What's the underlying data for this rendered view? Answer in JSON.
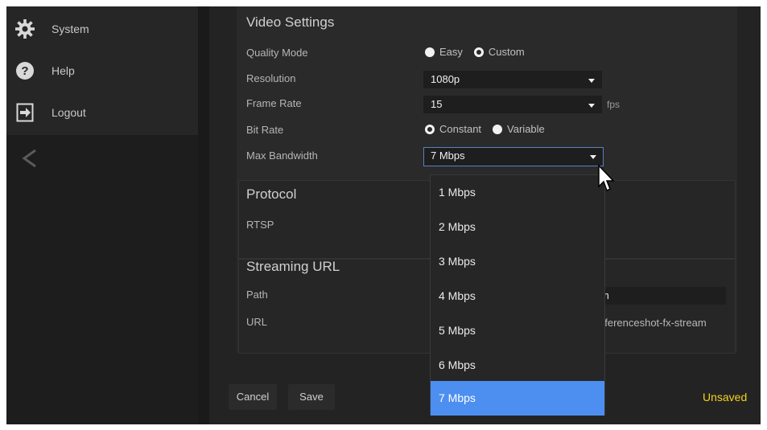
{
  "sidebar": {
    "items": [
      {
        "label": "System",
        "icon": "gear-icon"
      },
      {
        "label": "Help",
        "icon": "help-icon"
      },
      {
        "label": "Logout",
        "icon": "logout-icon"
      }
    ],
    "collapse_icon": "chevron-left-icon"
  },
  "video_settings": {
    "title": "Video Settings",
    "quality_mode": {
      "label": "Quality Mode",
      "options": [
        "Easy",
        "Custom"
      ],
      "selected": "Custom"
    },
    "resolution": {
      "label": "Resolution",
      "value": "1080p"
    },
    "frame_rate": {
      "label": "Frame Rate",
      "value": "15",
      "unit": "fps"
    },
    "bit_rate": {
      "label": "Bit Rate",
      "options": [
        "Constant",
        "Variable"
      ],
      "selected": "Constant"
    },
    "max_bandwidth": {
      "label": "Max Bandwidth",
      "value": "7 Mbps",
      "options": [
        "1 Mbps",
        "2 Mbps",
        "3 Mbps",
        "4 Mbps",
        "5 Mbps",
        "6 Mbps",
        "7 Mbps"
      ],
      "selected_index": 6
    }
  },
  "protocol": {
    "title": "Protocol",
    "rtsp_label": "RTSP"
  },
  "streaming_url": {
    "title": "Streaming URL",
    "path_label": "Path",
    "path_value": "m",
    "url_label": "URL",
    "url_value": "nferenceshot-fx-stream"
  },
  "footer": {
    "cancel_label": "Cancel",
    "save_label": "Save",
    "status_text": "Unsaved"
  },
  "colors": {
    "accent": "#4d8ff0",
    "unsaved": "#f2d21c",
    "background": "#1a1a1a"
  }
}
